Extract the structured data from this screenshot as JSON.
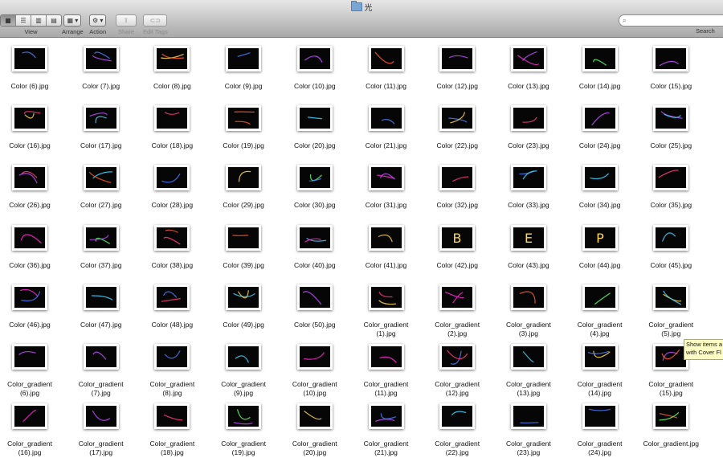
{
  "window": {
    "title": "光"
  },
  "toolbar": {
    "view_label": "View",
    "arrange_label": "Arrange",
    "action_label": "Action",
    "share_label": "Share",
    "edit_tags_label": "Edit Tags",
    "search_label": "Search",
    "search_value": "",
    "view_icons": [
      "icon-view-icon",
      "list-view-icon",
      "column-view-icon",
      "cover-flow-icon"
    ]
  },
  "tooltip": {
    "line1": "Show items a",
    "line2": "with Cover Fl"
  },
  "files": [
    [
      "Color (6).jpg",
      "Color (7).jpg",
      "Color (8).jpg",
      "Color (9).jpg",
      "Color (10).jpg",
      "Color (11).jpg",
      "Color (12).jpg",
      "Color (13).jpg",
      "Color (14).jpg",
      "Color (15).jpg"
    ],
    [
      "Color (16).jpg",
      "Color (17).jpg",
      "Color (18).jpg",
      "Color (19).jpg",
      "Color (20).jpg",
      "Color (21).jpg",
      "Color (22).jpg",
      "Color (23).jpg",
      "Color (24).jpg",
      "Color (25).jpg"
    ],
    [
      "Color (26).jpg",
      "Color (27).jpg",
      "Color (28).jpg",
      "Color (29).jpg",
      "Color (30).jpg",
      "Color (31).jpg",
      "Color (32).jpg",
      "Color (33).jpg",
      "Color (34).jpg",
      "Color (35).jpg"
    ],
    [
      "Color (36).jpg",
      "Color (37).jpg",
      "Color (38).jpg",
      "Color (39).jpg",
      "Color (40).jpg",
      "Color (41).jpg",
      "Color (42).jpg",
      "Color (43).jpg",
      "Color (44).jpg",
      "Color (45).jpg"
    ],
    [
      "Color (46).jpg",
      "Color (47).jpg",
      "Color (48).jpg",
      "Color (49).jpg",
      "Color (50).jpg",
      "Color_gradient\n(1).jpg",
      "Color_gradient\n(2).jpg",
      "Color_gradient\n(3).jpg",
      "Color_gradient\n(4).jpg",
      "Color_gradient\n(5).jpg"
    ],
    [
      "Color_gradient\n(6).jpg",
      "Color_gradient\n(7).jpg",
      "Color_gradient\n(8).jpg",
      "Color_gradient\n(9).jpg",
      "Color_gradient\n(10).jpg",
      "Color_gradient\n(11).jpg",
      "Color_gradient\n(12).jpg",
      "Color_gradient\n(13).jpg",
      "Color_gradient\n(14).jpg",
      "Color_gradient\n(15).jpg"
    ],
    [
      "Color_gradient\n(16).jpg",
      "Color_gradient\n(17).jpg",
      "Color_gradient\n(18).jpg",
      "Color_gradient\n(19).jpg",
      "Color_gradient\n(20).jpg",
      "Color_gradient\n(21).jpg",
      "Color_gradient\n(22).jpg",
      "Color_gradient\n(23).jpg",
      "Color_gradient\n(24).jpg",
      "Color_gradient.jpg"
    ]
  ],
  "thumb_letters": {
    "Color (42).jpg": "B",
    "Color (43).jpg": "E",
    "Color (44).jpg": "P"
  },
  "colors": {
    "thumbnail_background": "#060606",
    "light_trails": [
      "#ff3b7a",
      "#c04bff",
      "#ff5a2a",
      "#3fd2ff",
      "#5aff6a",
      "#ffd84a",
      "#ff2ad4",
      "#4a7dff"
    ]
  }
}
